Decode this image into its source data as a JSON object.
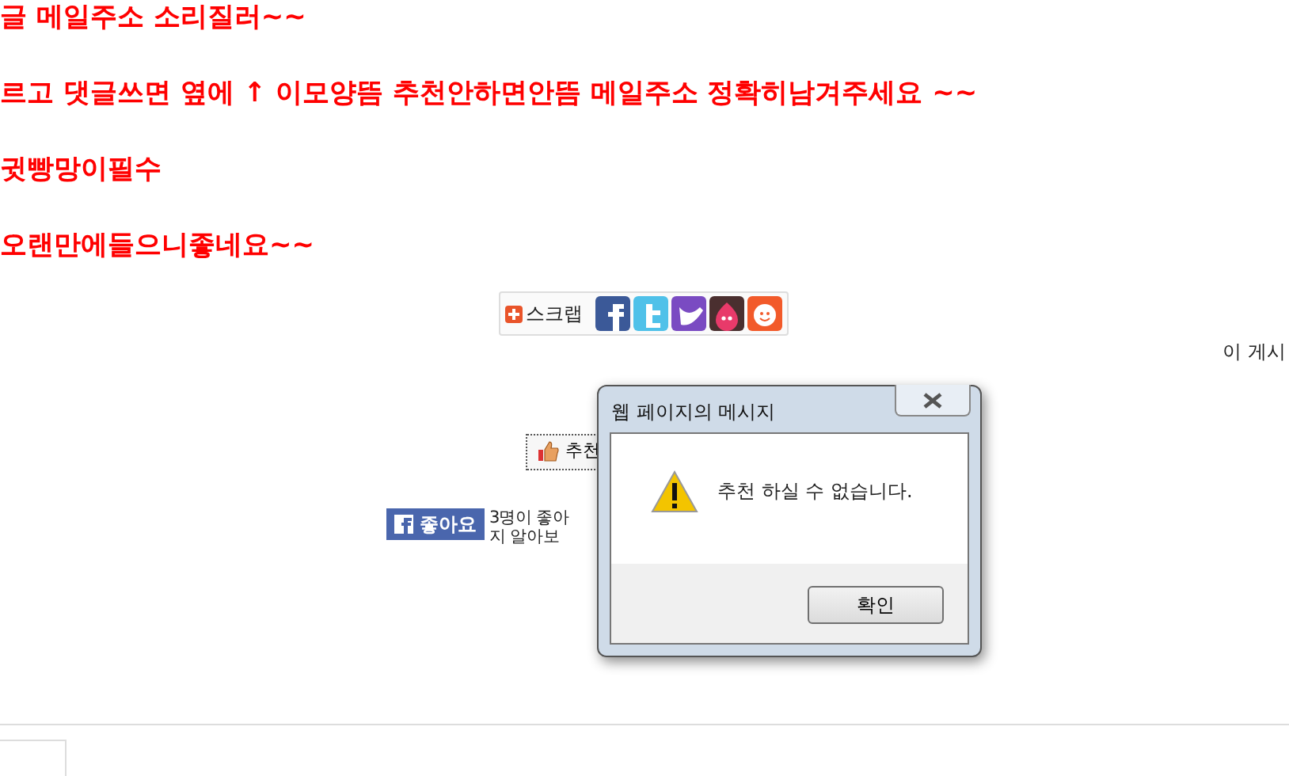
{
  "post_lines": [
    "글 메일주소  소리질러~~",
    "르고 댓글쓰면 옆에 ↑ 이모양뜸 추천안하면안뜸  메일주소 정확히남겨주세요 ~~",
    "귓빵망이필수",
    "오랜만에들으니좋네요~~"
  ],
  "share_bar": {
    "label": "스크랩"
  },
  "side_note": "이 게시",
  "recommend_button": {
    "label": "추천"
  },
  "like": {
    "button": "좋아요",
    "text_lines": [
      "3명이 좋아",
      "지 알아보"
    ]
  },
  "dialog": {
    "title": "웹 페이지의 메시지",
    "message": "추천 하실 수 없습니다.",
    "button": "확인"
  }
}
